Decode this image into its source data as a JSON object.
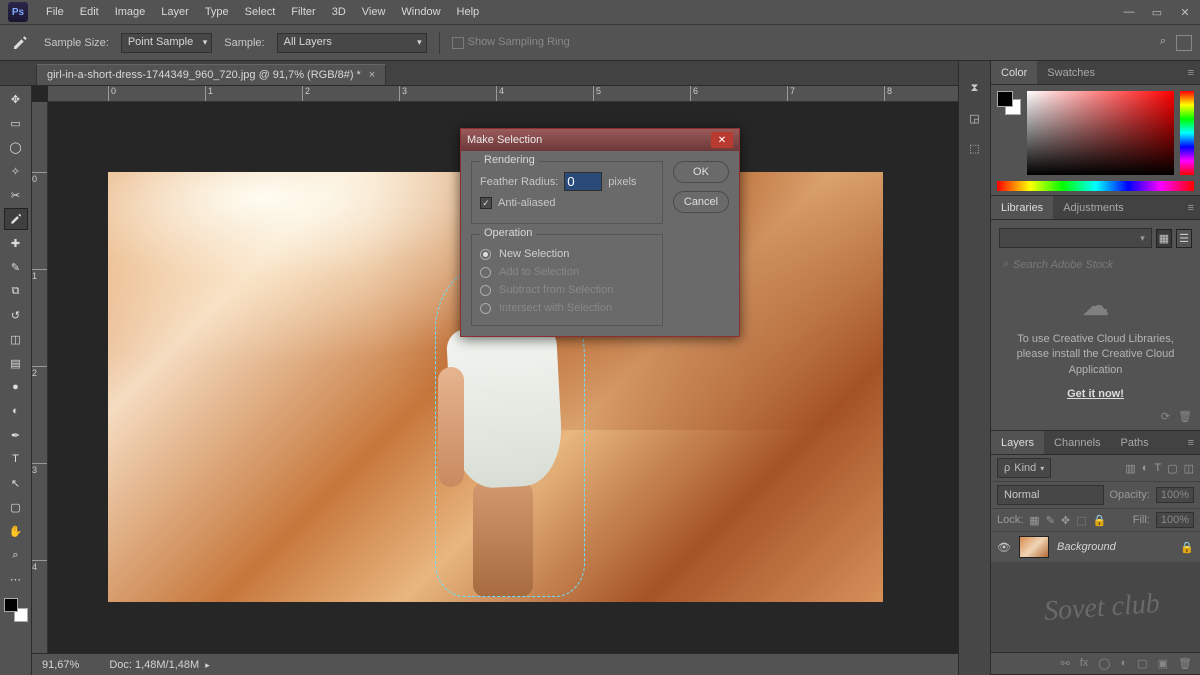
{
  "menu": {
    "items": [
      "File",
      "Edit",
      "Image",
      "Layer",
      "Type",
      "Select",
      "Filter",
      "3D",
      "View",
      "Window",
      "Help"
    ]
  },
  "options": {
    "sample_size_label": "Sample Size:",
    "sample_size_value": "Point Sample",
    "sample_label": "Sample:",
    "sample_value": "All Layers",
    "show_ring": "Show Sampling Ring"
  },
  "doc": {
    "tab": "girl-in-a-short-dress-1744349_960_720.jpg @ 91,7% (RGB/8#) *"
  },
  "ruler_h": [
    "0",
    "1",
    "2",
    "3",
    "4",
    "5",
    "6",
    "7",
    "8"
  ],
  "ruler_v": [
    "0",
    "1",
    "2",
    "3",
    "4"
  ],
  "status": {
    "zoom": "91,67%",
    "docinfo": "Doc: 1,48M/1,48M"
  },
  "color_panel": {
    "tabs": [
      "Color",
      "Swatches"
    ]
  },
  "libs": {
    "tabs": [
      "Libraries",
      "Adjustments"
    ],
    "search_placeholder": "Search Adobe Stock",
    "msg1": "To use Creative Cloud Libraries, please install the Creative Cloud Application",
    "link": "Get it now!"
  },
  "layers": {
    "tabs": [
      "Layers",
      "Channels",
      "Paths"
    ],
    "kind": "Kind",
    "blend": "Normal",
    "opacity_label": "Opacity:",
    "opacity_value": "100%",
    "lock_label": "Lock:",
    "fill_label": "Fill:",
    "fill_value": "100%",
    "layer_name": "Background"
  },
  "dialog": {
    "title": "Make Selection",
    "rendering": "Rendering",
    "feather_label": "Feather Radius:",
    "feather_value": "0",
    "pixels": "pixels",
    "antialias": "Anti-aliased",
    "operation": "Operation",
    "ops": [
      "New Selection",
      "Add to Selection",
      "Subtract from Selection",
      "Intersect with Selection"
    ],
    "ok": "OK",
    "cancel": "Cancel"
  },
  "watermark": "Sovet club"
}
